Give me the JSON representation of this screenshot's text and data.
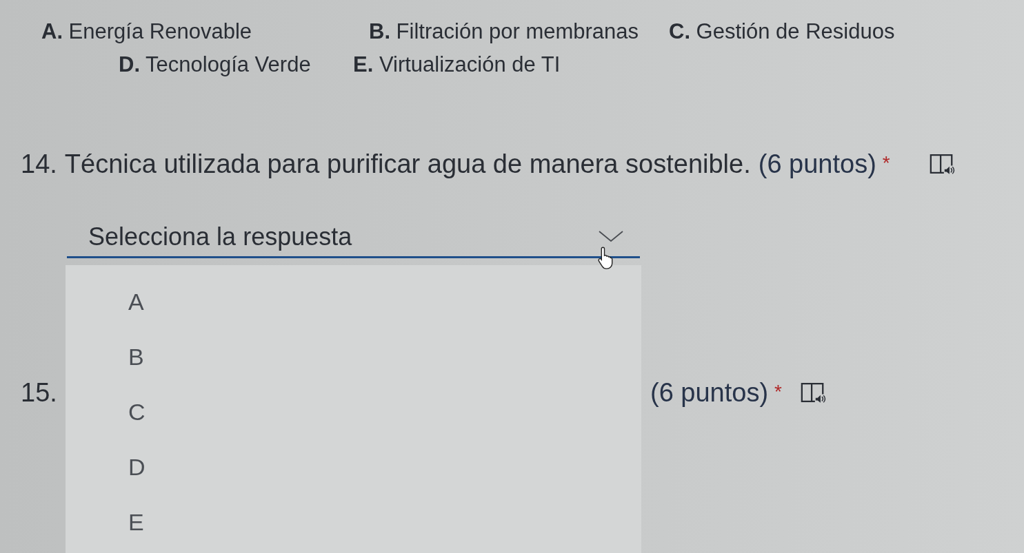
{
  "option_legend": {
    "lines": [
      {
        "items": [
          {
            "text": "**A.** Energía Renovable"
          },
          {
            "text": "**B.** Filtración por membranas"
          },
          {
            "text": "**C.** Gestión de Residuos"
          }
        ]
      },
      {
        "items": [
          {
            "text": "**D.** Tecnología Verde"
          },
          {
            "text": "**E.** Virtualización de TI"
          }
        ]
      }
    ]
  },
  "questions": [
    {
      "number": "14.",
      "text": "Técnica utilizada para purificar agua de manera sostenible.",
      "points": "(6 puntos)",
      "required_mark": "*",
      "dropdown": {
        "placeholder": "Selecciona la respuesta",
        "expanded": true,
        "options": [
          {
            "label": "A",
            "selected": false
          },
          {
            "label": "B",
            "selected": false
          },
          {
            "label": "C",
            "selected": false
          },
          {
            "label": "D",
            "selected": false
          },
          {
            "label": "E",
            "selected": false
          }
        ]
      }
    },
    {
      "number": "15.",
      "points": "(6 puntos)",
      "required_mark": "*"
    }
  ]
}
